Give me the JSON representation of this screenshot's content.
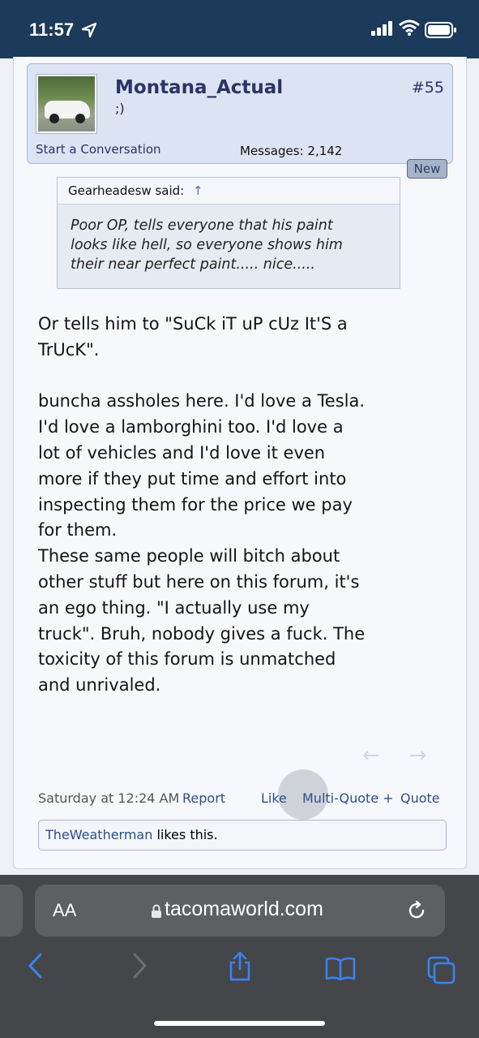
{
  "status_bar": {
    "time": "11:57"
  },
  "post": {
    "username": "Montana_Actual",
    "user_title": ";)",
    "post_number": "#55",
    "start_conversation": "Start a Conversation",
    "messages_label": "Messages:",
    "messages_count": "2,142",
    "new_badge": "New",
    "quote": {
      "author_said": "Gearheadesw said:",
      "arrow": "↑",
      "lines": [
        "Poor OP, tells everyone that his paint",
        "looks like hell, so everyone shows him",
        "their near perfect paint..... nice....."
      ]
    },
    "body_lines_1": [
      "Or tells him to \"SuCk iT uP cUz It'S a",
      "TrUcK\"."
    ],
    "body_lines_2": [
      "buncha assholes here. I'd love a Tesla.",
      "I'd love a lamborghini too. I'd love a",
      "lot of vehicles and I'd love it even",
      "more if they put time and effort into",
      "inspecting them for the price we pay",
      "for them.",
      "These same people will bitch about",
      "other stuff but here on this forum, it's",
      "an ego thing. \"I actually use my",
      "truck\". Bruh, nobody gives a fuck. The",
      "toxicity of this forum is unmatched",
      "and unrivaled."
    ],
    "footer": {
      "datetime": "Saturday at 12:24 AM",
      "report": "Report",
      "like": "Like",
      "multi_quote": "Multi-Quote +",
      "quote": "Quote"
    },
    "likes": {
      "liker": "TheWeatherman",
      "suffix": " likes this."
    }
  },
  "browser": {
    "text_size_label": "AA",
    "domain": "tacomaworld.com"
  },
  "colors": {
    "accent": "#2a4f8a",
    "status_bar": "#1c3a5a",
    "safari_bar": "#444649",
    "ios_blue": "#3b82f6"
  }
}
